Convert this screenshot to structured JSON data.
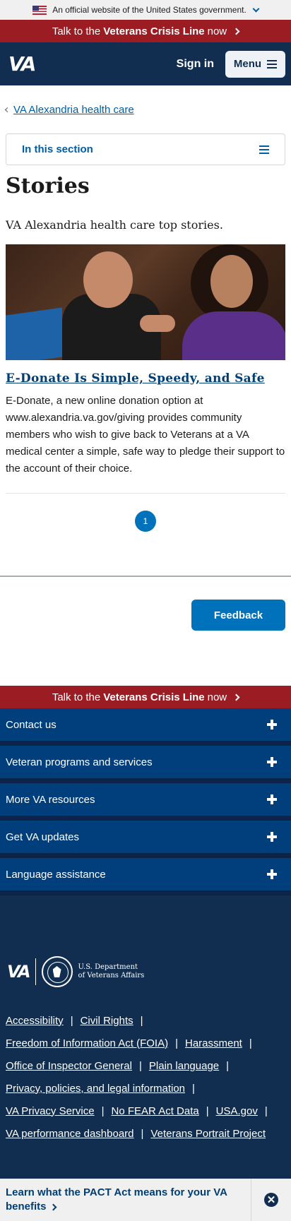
{
  "gov_banner": {
    "text": "An official website of the United States government.",
    "icons": [
      "us-flag-icon",
      "chevron-down-icon"
    ]
  },
  "crisis_line": {
    "prefix": "Talk to the ",
    "emphasis": "Veterans Crisis Line",
    "suffix": " now"
  },
  "header": {
    "logo": "VA",
    "sign_in": "Sign in",
    "menu": "Menu"
  },
  "breadcrumb": {
    "label": "VA Alexandria health care"
  },
  "section_nav": {
    "label": "In this section"
  },
  "page": {
    "title": "Stories",
    "intro": "VA Alexandria health care top stories."
  },
  "stories": [
    {
      "title": "E-Donate Is Simple, Speedy, and Safe",
      "description": "E-Donate, a new online donation option at www.alexandria.va.gov/giving provides community members who wish to give back to Veterans at a VA medical center a simple, safe way to pledge their support to the account of their choice."
    }
  ],
  "pagination": {
    "current": "1"
  },
  "feedback": {
    "label": "Feedback"
  },
  "footer": {
    "accordion": [
      "Contact us",
      "Veteran programs and services",
      "More VA resources",
      "Get VA updates",
      "Language assistance"
    ],
    "logo": {
      "va": "VA",
      "dept_line1": "U.S. Department",
      "dept_line2": "of Veterans Affairs"
    },
    "links": {
      "accessibility": "Accessibility",
      "civil_rights": "Civil Rights",
      "foia": "Freedom of Information Act (FOIA)",
      "harassment": "Harassment",
      "oig": "Office of Inspector General",
      "plain_language": "Plain language",
      "privacy": "Privacy, policies, and legal information",
      "va_privacy_service": "VA Privacy Service",
      "no_fear": "No FEAR Act Data",
      "usa_gov": "USA.gov",
      "performance": "VA performance dashboard",
      "portrait": "Veterans Portrait Project"
    }
  },
  "pact_banner": {
    "text": "Learn what the PACT Act means for your VA benefits"
  },
  "colors": {
    "header_bg": "#112e51",
    "crisis_red": "#9b1c22",
    "link_blue": "#005ea2",
    "button_blue": "#0071bb",
    "accordion_bg": "#003f7c"
  }
}
